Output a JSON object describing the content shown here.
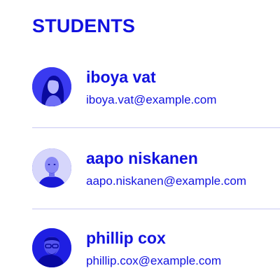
{
  "page": {
    "title": "STUDENTS"
  },
  "students": [
    {
      "name": "iboya vat",
      "email": "iboya.vat@example.com",
      "avatar": "person-avatar"
    },
    {
      "name": "aapo niskanen",
      "email": "aapo.niskanen@example.com",
      "avatar": "person-avatar"
    },
    {
      "name": "phillip cox",
      "email": "phillip.cox@example.com",
      "avatar": "person-avatar"
    }
  ],
  "colors": {
    "accent": "#1212e0",
    "divider": "#c9c9f3",
    "background": "#ffffff"
  }
}
